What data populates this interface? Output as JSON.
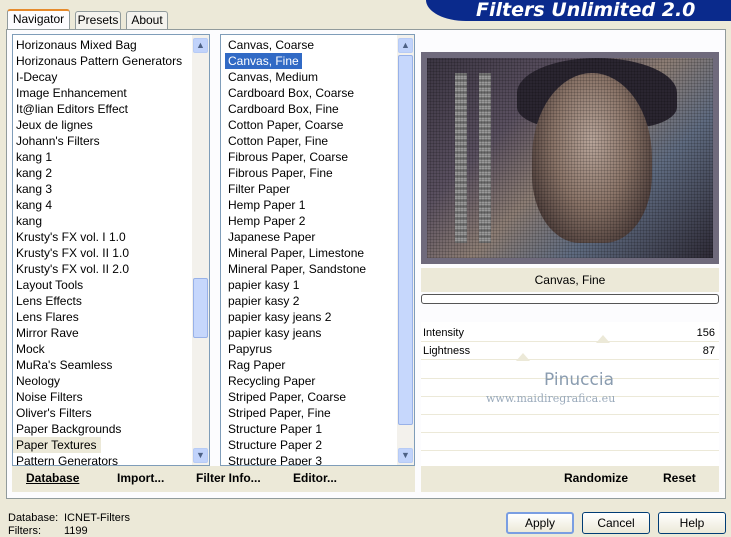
{
  "banner_title": "Filters Unlimited 2.0",
  "tabs": [
    "Navigator",
    "Presets",
    "About"
  ],
  "categories": [
    "Horizonaus Mixed Bag",
    "Horizonaus Pattern Generators",
    "I-Decay",
    "Image Enhancement",
    "It@lian Editors Effect",
    "Jeux de lignes",
    "Johann's Filters",
    "kang 1",
    "kang 2",
    "kang 3",
    "kang 4",
    "kang",
    "Krusty's FX vol. I 1.0",
    "Krusty's FX vol. II 1.0",
    "Krusty's FX vol. II 2.0",
    "Layout Tools",
    "Lens Effects",
    "Lens Flares",
    "Mirror Rave",
    "Mock",
    "MuRa's Seamless",
    "Neology",
    "Noise Filters",
    "Oliver's Filters",
    "Paper Backgrounds",
    "Paper Textures",
    "Pattern Generators"
  ],
  "selected_category": "Paper Textures",
  "filters": [
    "Canvas, Coarse",
    "Canvas, Fine",
    "Canvas, Medium",
    "Cardboard Box, Coarse",
    "Cardboard Box, Fine",
    "Cotton Paper, Coarse",
    "Cotton Paper, Fine",
    "Fibrous Paper, Coarse",
    "Fibrous Paper, Fine",
    "Filter Paper",
    "Hemp Paper 1",
    "Hemp Paper 2",
    "Japanese Paper",
    "Mineral Paper, Limestone",
    "Mineral Paper, Sandstone",
    "papier kasy 1",
    "papier kasy 2",
    "papier kasy jeans 2",
    "papier kasy jeans",
    "Papyrus",
    "Rag Paper",
    "Recycling Paper",
    "Striped Paper, Coarse",
    "Striped Paper, Fine",
    "Structure Paper 1",
    "Structure Paper 2",
    "Structure Paper 3"
  ],
  "selected_filter": "Canvas, Fine",
  "preview_filter_name": "Canvas, Fine",
  "params": [
    {
      "label": "Intensity",
      "value": "156"
    },
    {
      "label": "Lightness",
      "value": "87"
    }
  ],
  "watermark": {
    "name": "Pinuccia",
    "url": "www.maidiregrafica.eu"
  },
  "bottom_left": {
    "database": "Database",
    "import": "Import...",
    "filter_info": "Filter Info...",
    "editor": "Editor..."
  },
  "bottom_right": {
    "randomize": "Randomize",
    "reset": "Reset"
  },
  "status": {
    "database_label": "Database:",
    "database_value": "ICNET-Filters",
    "filters_label": "Filters:",
    "filters_value": "1199"
  },
  "buttons": {
    "apply": "Apply",
    "cancel": "Cancel",
    "help": "Help"
  },
  "colors": {
    "banner": "#0a2a8c",
    "selection": "#316ac5",
    "face": "#ece9d8"
  }
}
